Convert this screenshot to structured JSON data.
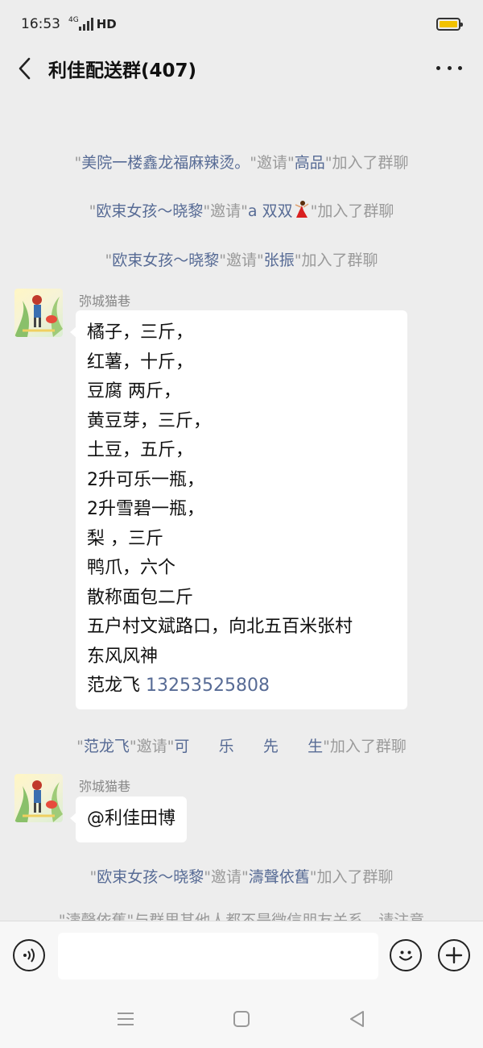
{
  "status_bar": {
    "time": "16:53",
    "network": "4G",
    "hd": "HD"
  },
  "header": {
    "title": "利佳配送群(407)"
  },
  "notices": [
    {
      "q1": "\"",
      "name1": "美院一楼鑫龙福麻辣烫。",
      "mid": "\"邀请\"",
      "name2": "高品",
      "end": "\"加入了群聊"
    },
    {
      "q1": "\"",
      "name1": "欧束女孩～晓黎",
      "mid": "\"邀请\"",
      "name2": "a  双双",
      "end": "\"加入了群聊"
    },
    {
      "q1": "\"",
      "name1": "欧束女孩～晓黎",
      "mid": "\"邀请\"",
      "name2": "张振",
      "end": "\"加入了群聊"
    },
    {
      "q1": "\"",
      "name1": "范龙飞",
      "mid": "\"邀请\"",
      "name2": "可      乐      先      生",
      "end": "\"加入了群聊"
    },
    {
      "q1": "\"",
      "name1": "欧束女孩～晓黎",
      "mid": "\"邀请\"",
      "name2": "濤聲依舊",
      "end": "\"加入了群聊"
    },
    {
      "text": "\"濤聲依舊\"与群里其他人都不是微信朋友关系，请注意"
    }
  ],
  "messages": [
    {
      "sender": "弥城猫巷",
      "lines": [
        "橘子，三斤，",
        "红薯，十斤，",
        "豆腐 两斤，",
        "黄豆芽，三斤，",
        "土豆，五斤，",
        "2升可乐一瓶，",
        "2升雪碧一瓶，",
        "梨 ，三斤",
        "鸭爪，六个",
        "散称面包二斤",
        "五户村文斌路口，向北五百米张村",
        "东风风神"
      ],
      "contact_name": " 范龙飞 ",
      "contact_phone": "13253525808"
    },
    {
      "sender": "弥城猫巷",
      "text": "@利佳田博"
    }
  ],
  "input": {
    "placeholder": ""
  },
  "icons": {
    "back": "back-arrow-icon",
    "more": "more-icon",
    "voice": "voice-icon",
    "emoji": "emoji-icon",
    "plus": "plus-icon",
    "dancer": "dancer-emoji-icon"
  },
  "colors": {
    "link": "#576b95",
    "notice": "#9a9a9a",
    "background": "#ededed",
    "battery": "#f2c200"
  }
}
